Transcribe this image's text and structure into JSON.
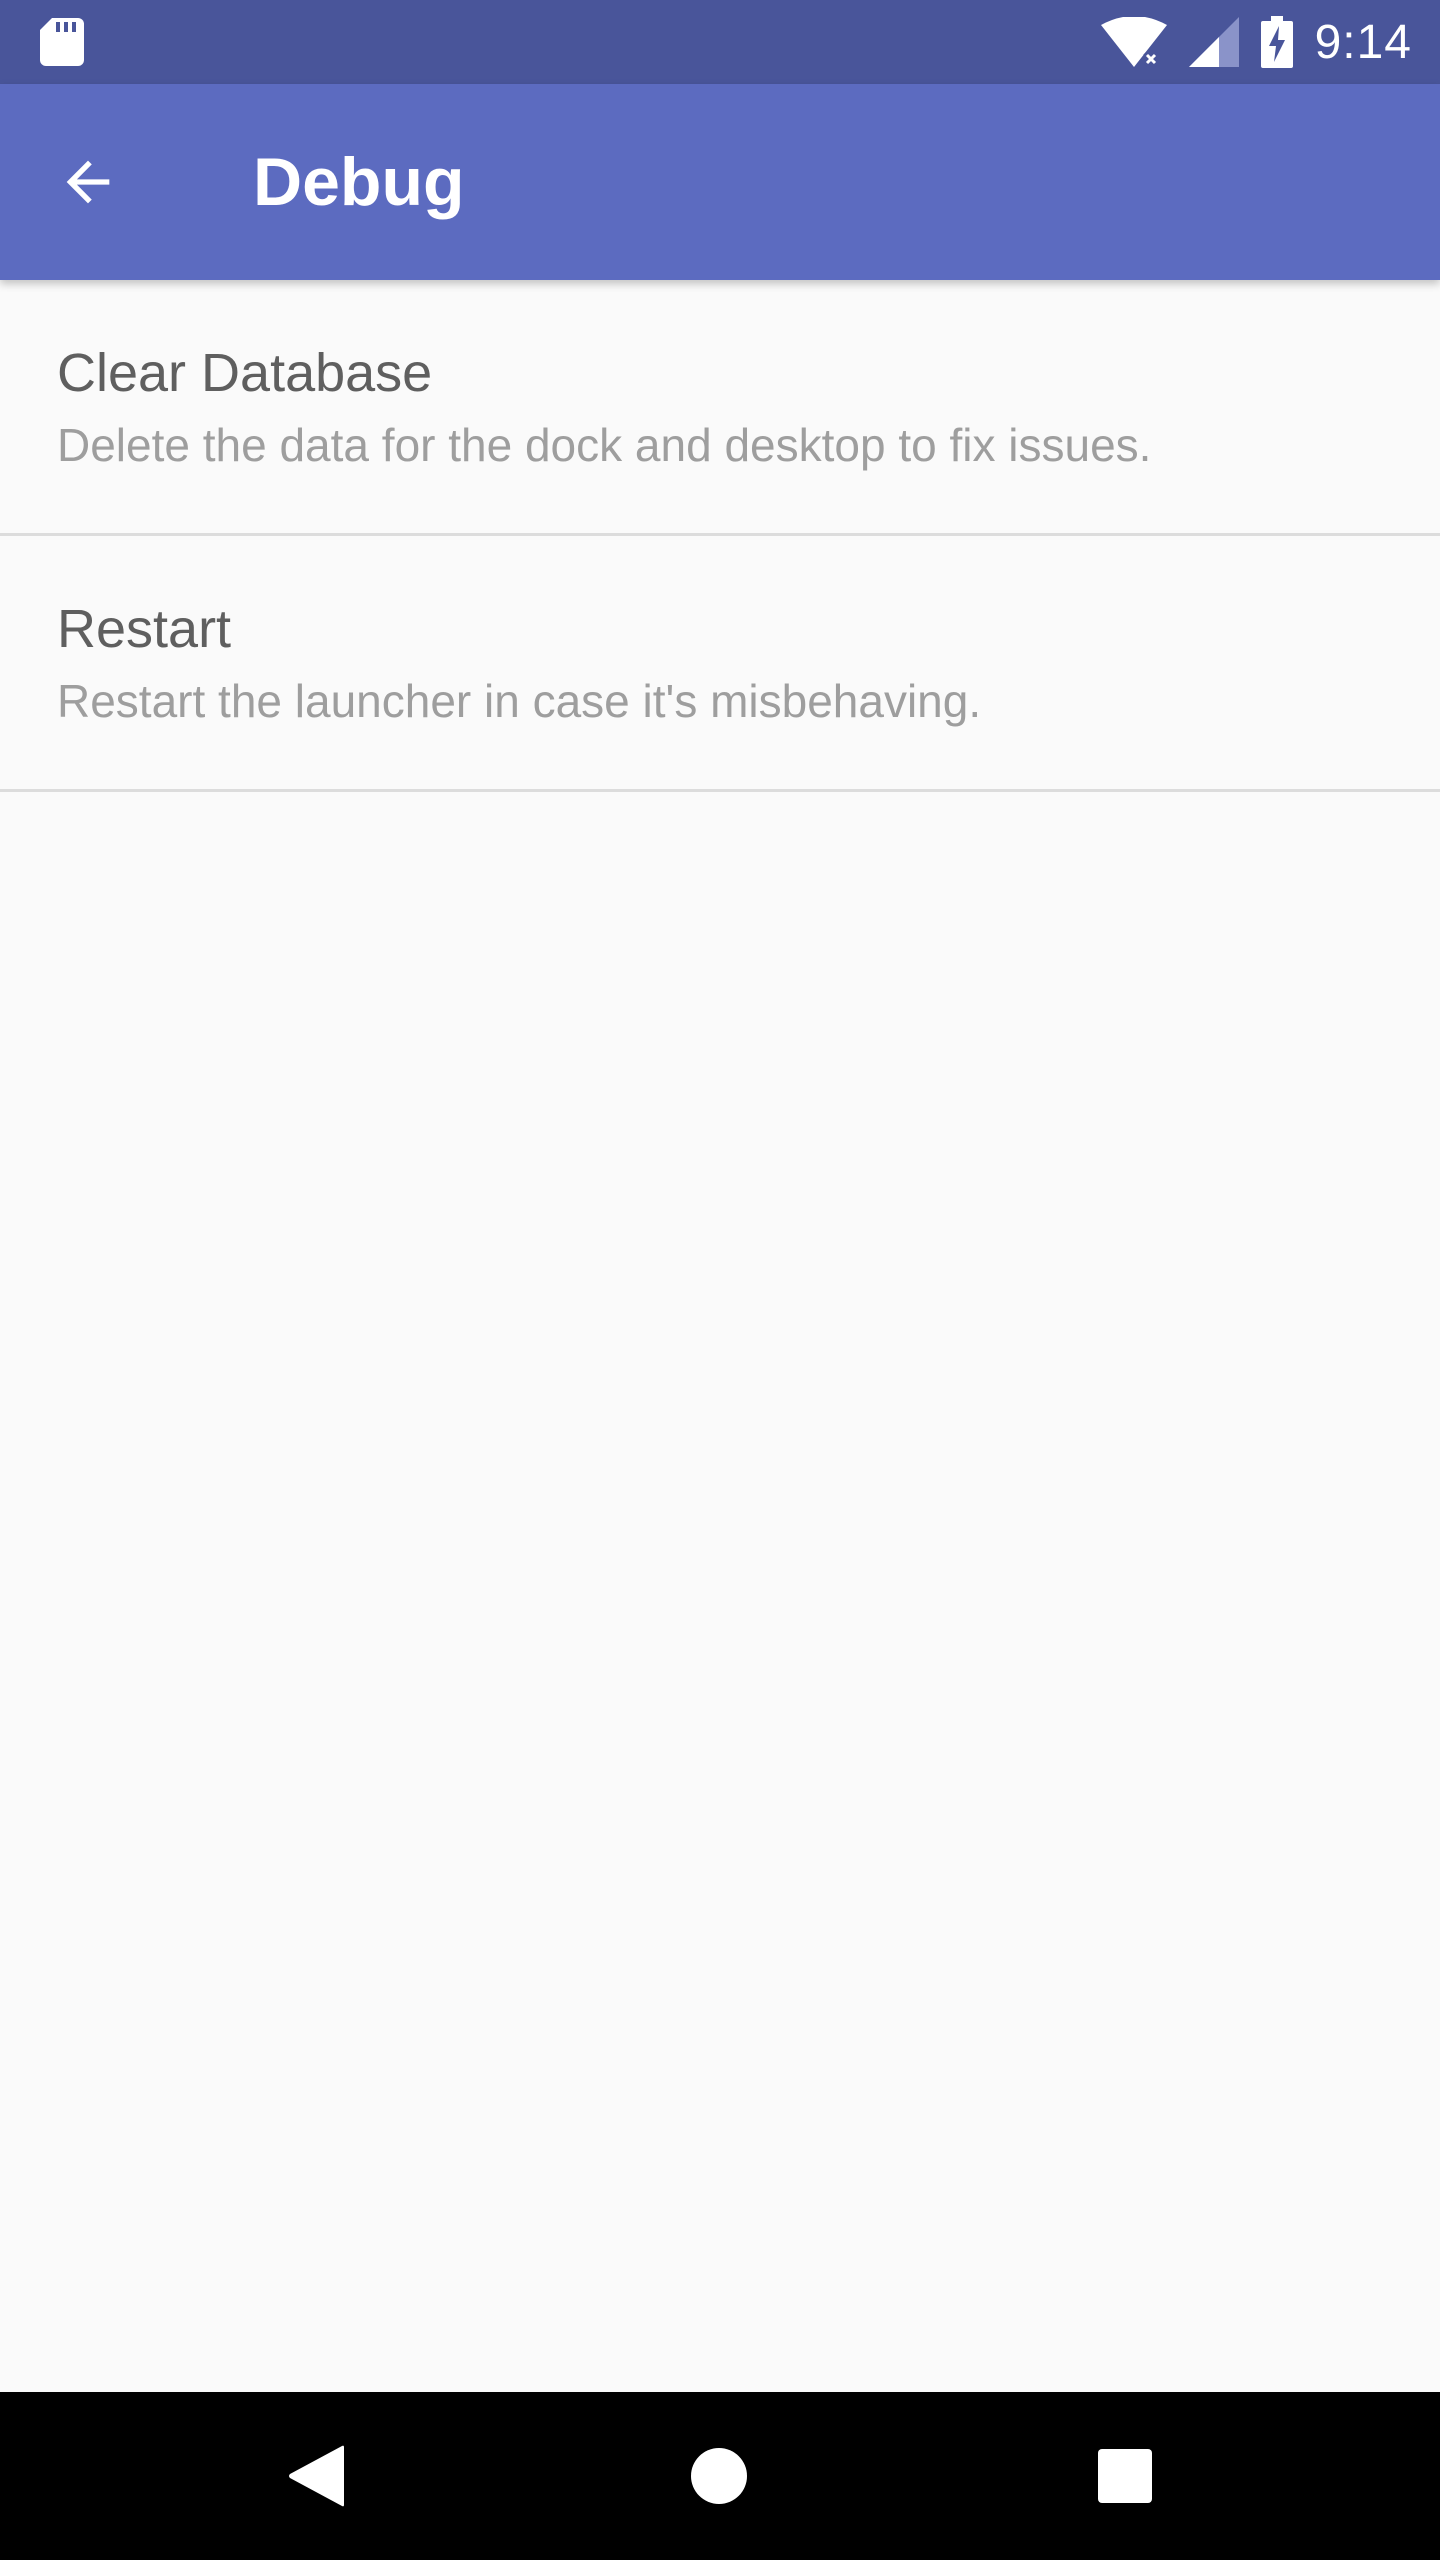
{
  "status_bar": {
    "time": "9:14",
    "icons": [
      "sd-card-icon",
      "wifi-icon",
      "signal-icon",
      "battery-charging-icon"
    ]
  },
  "app_bar": {
    "title": "Debug",
    "back_icon": "arrow-back-icon",
    "background_color": "#5c6bc0",
    "status_bar_color": "#49559a"
  },
  "preferences": [
    {
      "title": "Clear Database",
      "summary": "Delete the data for the dock and desktop to fix issues."
    },
    {
      "title": "Restart",
      "summary": "Restart the launcher in case it's misbehaving."
    }
  ],
  "nav_bar": {
    "icons": [
      "back-triangle-icon",
      "home-circle-icon",
      "recents-square-icon"
    ]
  }
}
